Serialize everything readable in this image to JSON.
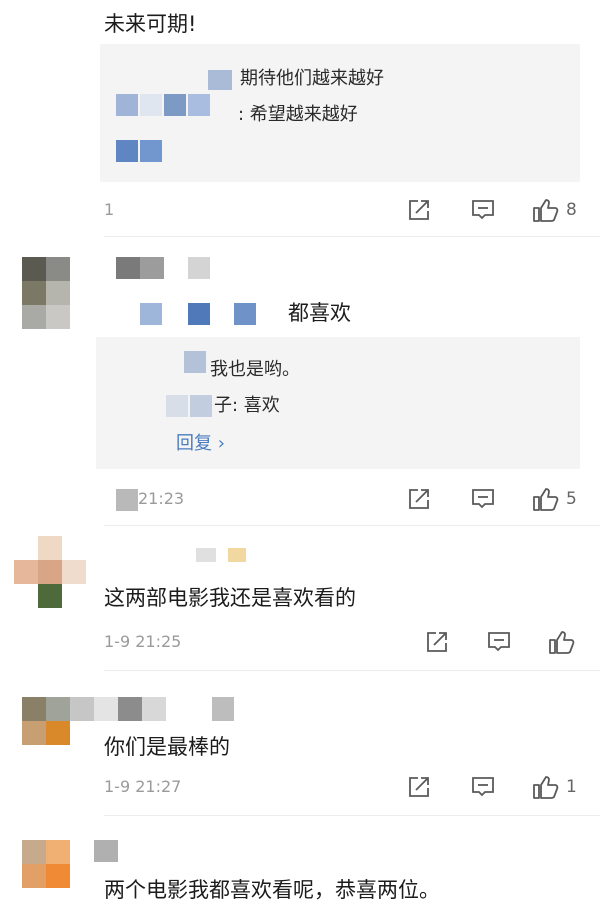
{
  "comments": [
    {
      "text": "未来可期!",
      "replies": [
        "期待他们越来越好",
        ": 希望越来越好"
      ],
      "time": "1",
      "likes": "8"
    },
    {
      "text": "都喜欢",
      "replies": [
        "我也是哟。",
        "子: 喜欢"
      ],
      "more": "回复 ›",
      "time": "21:23",
      "likes": "5"
    },
    {
      "text": "这两部电影我还是喜欢看的",
      "time": "1-9 21:25",
      "likes": ""
    },
    {
      "text": "你们是最棒的",
      "time": "1-9 21:27",
      "likes": "1"
    },
    {
      "text": "两个电影我都喜欢看呢，恭喜两位。"
    }
  ],
  "icons": {
    "share": "share-icon",
    "reply": "comment-icon",
    "like": "thumbs-up-icon"
  },
  "colors": {
    "link": "#4a7cbf",
    "meta": "#9a9a9a",
    "reply_bg": "#f4f4f4"
  }
}
